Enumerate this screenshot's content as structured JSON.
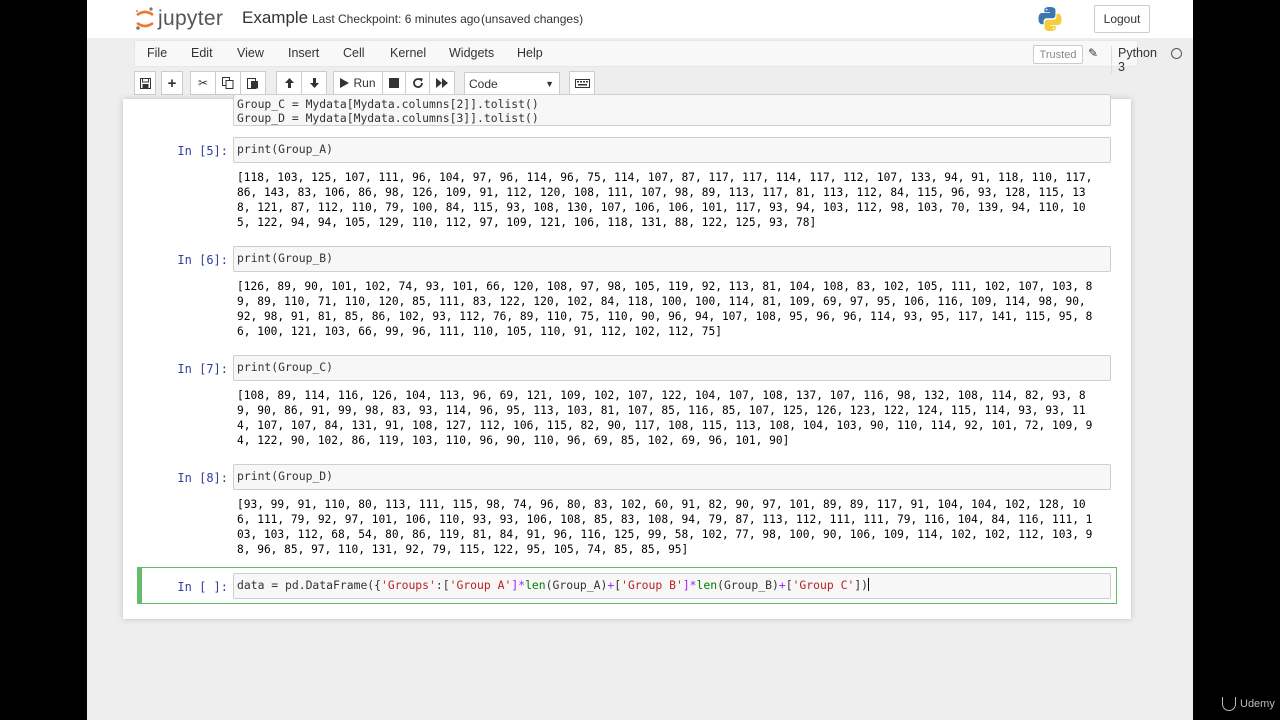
{
  "header": {
    "logo_text": "jupyter",
    "notebook_name": "Example",
    "checkpoint": "Last Checkpoint: 6 minutes ago",
    "unsaved": "(unsaved changes)",
    "logout_label": "Logout"
  },
  "menubar": {
    "items": [
      "File",
      "Edit",
      "View",
      "Insert",
      "Cell",
      "Kernel",
      "Widgets",
      "Help"
    ],
    "trusted": "Trusted",
    "kernel": "Python 3"
  },
  "toolbar": {
    "run_label": "Run",
    "cell_type": "Code"
  },
  "cells": [
    {
      "partial_input_line1": "Group_C = Mydata[Mydata.columns[2]].tolist()",
      "partial_input_line2": "Group_D = Mydata[Mydata.columns[3]].tolist()"
    },
    {
      "prompt": "In [5]:",
      "input": "print(Group_A)",
      "output": "[118, 103, 125, 107, 111, 96, 104, 97, 96, 114, 96, 75, 114, 107, 87, 117, 117, 114, 117, 112, 107, 133, 94, 91, 118, 110, 117,\n86, 143, 83, 106, 86, 98, 126, 109, 91, 112, 120, 108, 111, 107, 98, 89, 113, 117, 81, 113, 112, 84, 115, 96, 93, 128, 115, 13\n8, 121, 87, 112, 110, 79, 100, 84, 115, 93, 108, 130, 107, 106, 106, 101, 117, 93, 94, 103, 112, 98, 103, 70, 139, 94, 110, 10\n5, 122, 94, 94, 105, 129, 110, 112, 97, 109, 121, 106, 118, 131, 88, 122, 125, 93, 78]"
    },
    {
      "prompt": "In [6]:",
      "input": "print(Group_B)",
      "output": "[126, 89, 90, 101, 102, 74, 93, 101, 66, 120, 108, 97, 98, 105, 119, 92, 113, 81, 104, 108, 83, 102, 105, 111, 102, 107, 103, 8\n9, 89, 110, 71, 110, 120, 85, 111, 83, 122, 120, 102, 84, 118, 100, 100, 114, 81, 109, 69, 97, 95, 106, 116, 109, 114, 98, 90,\n92, 98, 91, 81, 85, 86, 102, 93, 112, 76, 89, 110, 75, 110, 90, 96, 94, 107, 108, 95, 96, 96, 114, 93, 95, 117, 141, 115, 95, 8\n6, 100, 121, 103, 66, 99, 96, 111, 110, 105, 110, 91, 112, 102, 112, 75]"
    },
    {
      "prompt": "In [7]:",
      "input": "print(Group_C)",
      "output": "[108, 89, 114, 116, 126, 104, 113, 96, 69, 121, 109, 102, 107, 122, 104, 107, 108, 137, 107, 116, 98, 132, 108, 114, 82, 93, 8\n9, 90, 86, 91, 99, 98, 83, 93, 114, 96, 95, 113, 103, 81, 107, 85, 116, 85, 107, 125, 126, 123, 122, 124, 115, 114, 93, 93, 11\n4, 107, 107, 84, 131, 91, 108, 127, 112, 106, 115, 82, 90, 117, 108, 115, 113, 108, 104, 103, 90, 110, 114, 92, 101, 72, 109, 9\n4, 122, 90, 102, 86, 119, 103, 110, 96, 90, 110, 96, 69, 85, 102, 69, 96, 101, 90]"
    },
    {
      "prompt": "In [8]:",
      "input": "print(Group_D)",
      "output": "[93, 99, 91, 110, 80, 113, 111, 115, 98, 74, 96, 80, 83, 102, 60, 91, 82, 90, 97, 101, 89, 89, 117, 91, 104, 104, 102, 128, 10\n6, 111, 79, 92, 97, 101, 106, 110, 93, 93, 106, 108, 85, 83, 108, 94, 79, 87, 113, 112, 111, 111, 79, 116, 104, 84, 116, 111, 1\n03, 103, 112, 68, 54, 80, 86, 119, 81, 84, 91, 96, 116, 125, 99, 58, 102, 77, 98, 100, 90, 106, 109, 114, 102, 102, 112, 103, 9\n8, 96, 85, 97, 110, 131, 92, 79, 115, 122, 95, 105, 74, 85, 85, 95]"
    },
    {
      "prompt": "In [ ]:",
      "input_parts": [
        "data = pd.DataFrame({",
        "'Groups'",
        ":[",
        "'Group A'",
        "]*",
        "len",
        "(Group_A)",
        "+",
        "[",
        "'Group B'",
        "]*",
        "len",
        "(Group_B)",
        "+",
        "[",
        "'Group C'",
        "])"
      ]
    }
  ],
  "watermark": "Udemy"
}
